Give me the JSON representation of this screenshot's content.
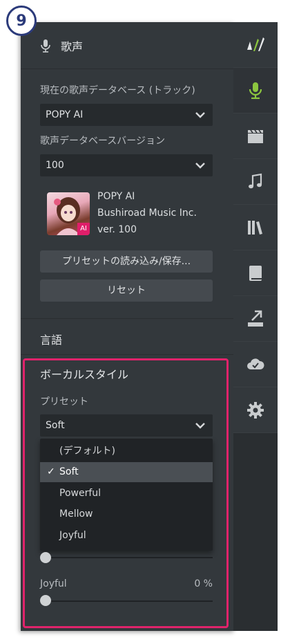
{
  "badge": "9",
  "header": {
    "title": "歌声",
    "icon": "microphone-icon"
  },
  "voicebank": {
    "db_label": "現在の歌声データベース (トラック)",
    "db_value": "POPY AI",
    "version_label": "歌声データベースバージョン",
    "version_value": "100",
    "name": "POPY AI",
    "publisher": "Bushiroad Music Inc.",
    "version_text": "ver. 100",
    "badge": "AI"
  },
  "buttons": {
    "preset_io": "プリセットの読み込み/保存...",
    "reset": "リセット"
  },
  "language": {
    "title": "言語"
  },
  "vocal_style": {
    "title": "ボーカルスタイル",
    "preset_label": "プリセット",
    "preset_value": "Soft",
    "options": [
      "(デフォルト)",
      "Soft",
      "Powerful",
      "Mellow",
      "Joyful"
    ],
    "selected_index": 1,
    "check": "✓",
    "joyful_label": "Joyful",
    "joyful_percent": "0 %",
    "joyful_level": 0,
    "prev_slider_level": 0
  },
  "sidebar": {
    "icons": [
      "logo-icon",
      "microphone-icon",
      "clapperboard-icon",
      "music-note-icon",
      "library-icon",
      "book-icon",
      "export-icon",
      "cloud-check-icon",
      "gear-icon"
    ],
    "active": "microphone-icon",
    "accent": "#8cc63f"
  },
  "colors": {
    "highlight": "#e0236b",
    "badge": "#2b3a7a"
  }
}
